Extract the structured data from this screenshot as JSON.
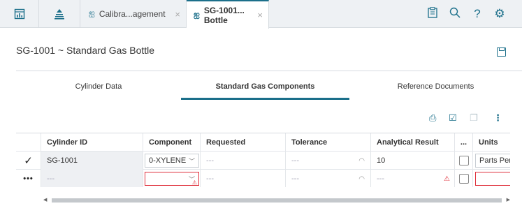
{
  "topbar": {
    "tabs": [
      {
        "label": "Calibra...agement",
        "active": false
      },
      {
        "label": "SG-1001... Bottle",
        "active": true
      }
    ],
    "close_glyph": "×"
  },
  "page": {
    "title": "SG-1001 ~ Standard Gas Bottle"
  },
  "section_tabs": [
    {
      "label": "Cylinder Data",
      "active": false
    },
    {
      "label": "Standard Gas Components",
      "active": true
    },
    {
      "label": "Reference Documents",
      "active": false
    }
  ],
  "grid": {
    "columns": [
      "Cylinder ID",
      "Component",
      "Requested",
      "Tolerance",
      "Analytical Result",
      "...",
      "Units"
    ],
    "rows": [
      {
        "marker": "✓",
        "cylinder_id": "SG-1001",
        "component": "0-XYLENE",
        "requested": "---",
        "tolerance": "---",
        "analytical_result": "10",
        "units": "Parts Per Million"
      },
      {
        "marker": "•••",
        "cylinder_id": "---",
        "component": "",
        "requested": "---",
        "tolerance": "---",
        "analytical_result": "---",
        "units": ""
      }
    ]
  },
  "colors": {
    "accent": "#1b6f8a",
    "error": "#e0303c",
    "topbar_bg": "#eef1f4"
  },
  "icons": {
    "topbar_left": [
      "dashboard-icon",
      "hierarchy-icon"
    ],
    "topbar_right": [
      "clipboard-icon",
      "search-icon",
      "help-icon",
      "settings-icon"
    ],
    "grid_toolbar": [
      "print-icon",
      "checklist-icon",
      "copy-icon",
      "more-vertical-icon"
    ]
  }
}
